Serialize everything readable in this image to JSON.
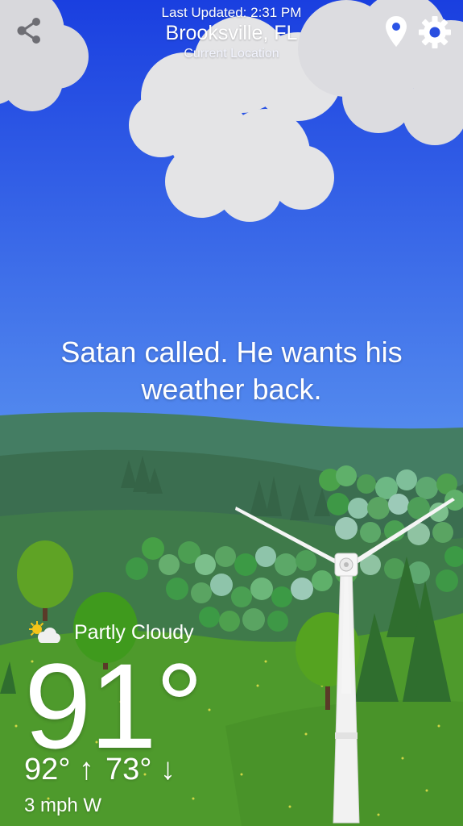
{
  "header": {
    "last_updated": "Last Updated: 2:31 PM",
    "city": "Brooksville, FL",
    "location_label": "Current Location"
  },
  "toolbar": {
    "share_icon": "share-icon",
    "location_icon": "map-pin-icon",
    "settings_icon": "gear-icon"
  },
  "message": "Satan called. He wants his weather back.",
  "conditions": {
    "icon": "partly-cloudy-icon",
    "label": "Partly Cloudy",
    "temperature": "91°",
    "high": "92°",
    "high_arrow": "↑",
    "low": "73°",
    "low_arrow": "↓",
    "wind": "3 mph W"
  },
  "colors": {
    "sky_top": "#1a3fe0",
    "sky_bottom": "#5a93f0",
    "hill_far": "#3f7a5a",
    "meadow": "#4f9a2e",
    "cloud": "#e6e6e8"
  }
}
